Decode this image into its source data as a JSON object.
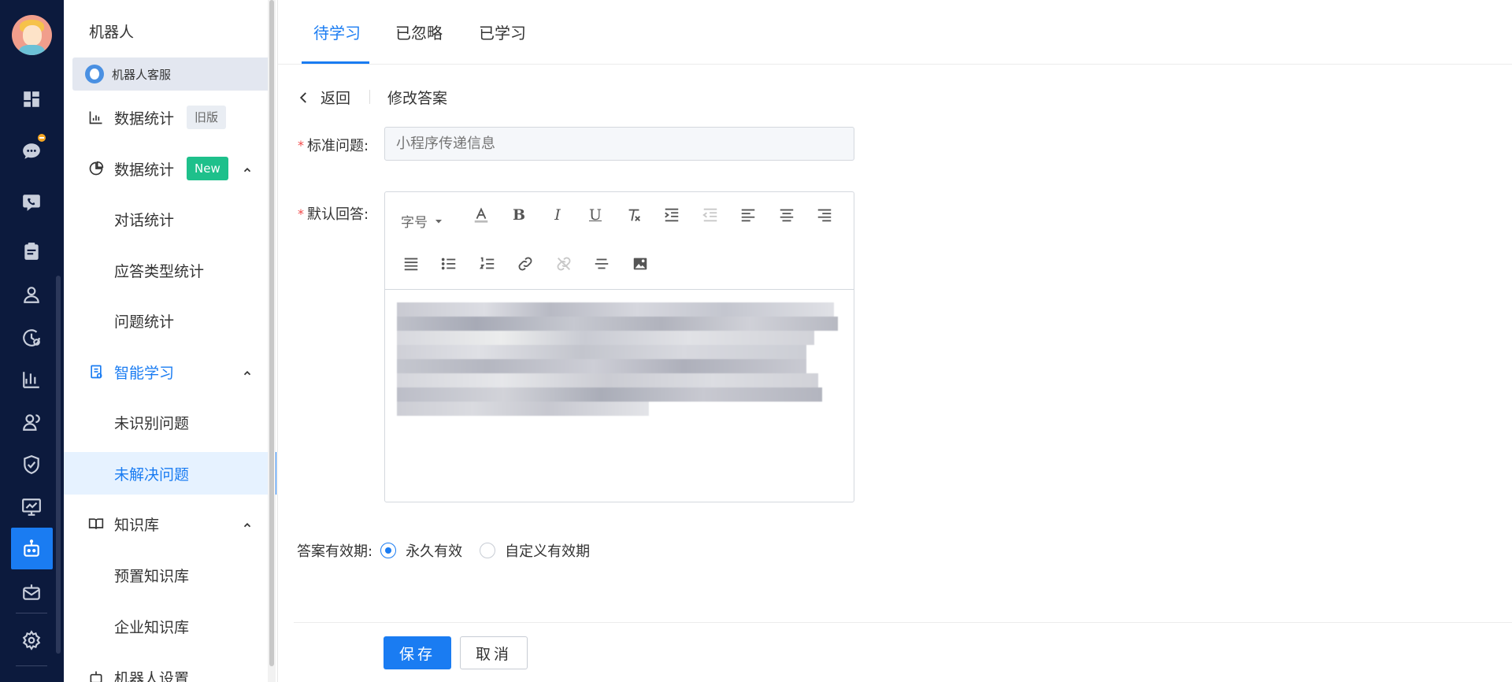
{
  "sidebar": {
    "title": "机器人",
    "robot_name": "机器人客服",
    "items": [
      {
        "label": "数据统计",
        "badge": "旧版"
      },
      {
        "label": "数据统计",
        "badge": "New"
      },
      {
        "label": "对话统计"
      },
      {
        "label": "应答类型统计"
      },
      {
        "label": "问题统计"
      },
      {
        "label": "智能学习"
      },
      {
        "label": "未识别问题"
      },
      {
        "label": "未解决问题"
      },
      {
        "label": "知识库"
      },
      {
        "label": "预置知识库"
      },
      {
        "label": "企业知识库"
      },
      {
        "label": "机器人设置"
      }
    ]
  },
  "tabs": [
    {
      "label": "待学习",
      "active": true
    },
    {
      "label": "已忽略",
      "active": false
    },
    {
      "label": "已学习",
      "active": false
    }
  ],
  "breadcrumb": {
    "back": "返回",
    "current": "修改答案"
  },
  "form": {
    "question_label": "标准问题:",
    "question_placeholder": "小程序传递信息",
    "answer_label": "默认回答:",
    "font_size": "字号",
    "validity_label": "答案有效期:",
    "validity_options": [
      {
        "label": "永久有效",
        "selected": true
      },
      {
        "label": "自定义有效期",
        "selected": false
      }
    ]
  },
  "actions": {
    "save": "保存",
    "cancel": "取消"
  },
  "colors": {
    "primary": "#1a7cf2",
    "rail": "#0c1a3d",
    "new_badge": "#1ec08b"
  }
}
